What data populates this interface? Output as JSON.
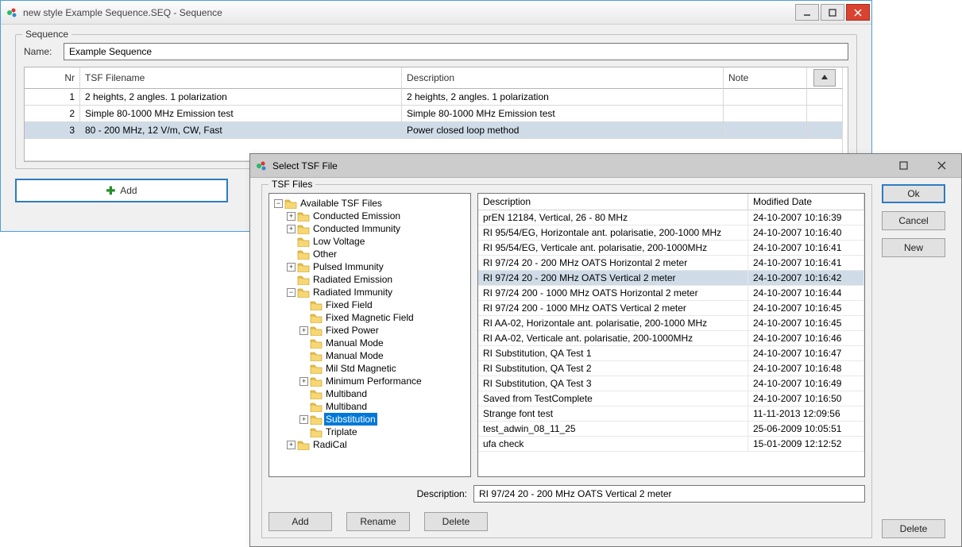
{
  "main_window": {
    "title": "new style Example Sequence.SEQ - Sequence",
    "group_label": "Sequence",
    "name_label": "Name:",
    "name_value": "Example Sequence",
    "columns": {
      "nr": "Nr",
      "tsf": "TSF Filename",
      "desc": "Description",
      "note": "Note"
    },
    "rows": [
      {
        "nr": "1",
        "tsf": "2 heights, 2 angles. 1 polarization",
        "desc": "2 heights, 2 angles. 1 polarization",
        "note": "",
        "selected": false
      },
      {
        "nr": "2",
        "tsf": "Simple 80-1000 MHz Emission test",
        "desc": "Simple 80-1000 MHz Emission test",
        "note": "",
        "selected": false
      },
      {
        "nr": "3",
        "tsf": "80 - 200 MHz, 12 V/m, CW, Fast",
        "desc": "Power closed loop method",
        "note": "",
        "selected": true
      }
    ],
    "add_label": "Add"
  },
  "dialog": {
    "title": "Select TSF File",
    "group_label": "TSF Files",
    "tree_root": "Available TSF Files",
    "tree": {
      "conducted_emission": "Conducted Emission",
      "conducted_immunity": "Conducted Immunity",
      "low_voltage": "Low Voltage",
      "other": "Other",
      "pulsed_immunity": "Pulsed Immunity",
      "radiated_emission": "Radiated Emission",
      "radiated_immunity": "Radiated Immunity",
      "fixed_field": "Fixed Field",
      "fixed_magnetic_field": "Fixed Magnetic Field",
      "fixed_power": "Fixed Power",
      "manual_mode": "Manual Mode",
      "manual_mode2": "Manual Mode",
      "mil_std_magnetic": "Mil Std Magnetic",
      "minimum_performance": "Minimum Performance",
      "multiband": "Multiband",
      "multiband2": "Multiband",
      "substitution": "Substitution",
      "triplate": "Triplate",
      "radical": "RadiCal"
    },
    "file_columns": {
      "desc": "Description",
      "date": "Modified Date"
    },
    "files": [
      {
        "desc": "prEN 12184, Vertical, 26 - 80 MHz",
        "date": "24-10-2007 10:16:39"
      },
      {
        "desc": "RI 95/54/EG, Horizontale ant. polarisatie, 200-1000 MHz",
        "date": "24-10-2007 10:16:40"
      },
      {
        "desc": "RI 95/54/EG, Verticale ant. polarisatie, 200-1000MHz",
        "date": "24-10-2007 10:16:41"
      },
      {
        "desc": "RI 97/24 20 - 200 MHz OATS Horizontal 2 meter",
        "date": "24-10-2007 10:16:41"
      },
      {
        "desc": "RI 97/24 20 - 200 MHz OATS Vertical 2 meter",
        "date": "24-10-2007 10:16:42",
        "selected": true
      },
      {
        "desc": "RI 97/24 200 - 1000 MHz OATS Horizontal 2 meter",
        "date": "24-10-2007 10:16:44"
      },
      {
        "desc": "RI 97/24 200 - 1000 MHz OATS Vertical 2 meter",
        "date": "24-10-2007 10:16:45"
      },
      {
        "desc": "RI AA-02, Horizontale ant. polarisatie, 200-1000 MHz",
        "date": "24-10-2007 10:16:45"
      },
      {
        "desc": "RI AA-02, Verticale ant. polarisatie, 200-1000MHz",
        "date": "24-10-2007 10:16:46"
      },
      {
        "desc": "RI Substitution, QA Test 1",
        "date": "24-10-2007 10:16:47"
      },
      {
        "desc": "RI Substitution, QA Test 2",
        "date": "24-10-2007 10:16:48"
      },
      {
        "desc": "RI Substitution, QA Test 3",
        "date": "24-10-2007 10:16:49"
      },
      {
        "desc": "Saved from TestComplete",
        "date": "24-10-2007 10:16:50"
      },
      {
        "desc": "Strange font test",
        "date": "11-11-2013 12:09:56"
      },
      {
        "desc": "test_adwin_08_11_25",
        "date": "25-06-2009 10:05:51"
      },
      {
        "desc": "ufa check",
        "date": "15-01-2009 12:12:52"
      }
    ],
    "desc_label": "Description:",
    "desc_value": "RI 97/24 20 - 200 MHz OATS Vertical 2 meter",
    "buttons": {
      "add": "Add",
      "rename": "Rename",
      "delete": "Delete",
      "ok": "Ok",
      "cancel": "Cancel",
      "new": "New",
      "delete2": "Delete"
    }
  }
}
